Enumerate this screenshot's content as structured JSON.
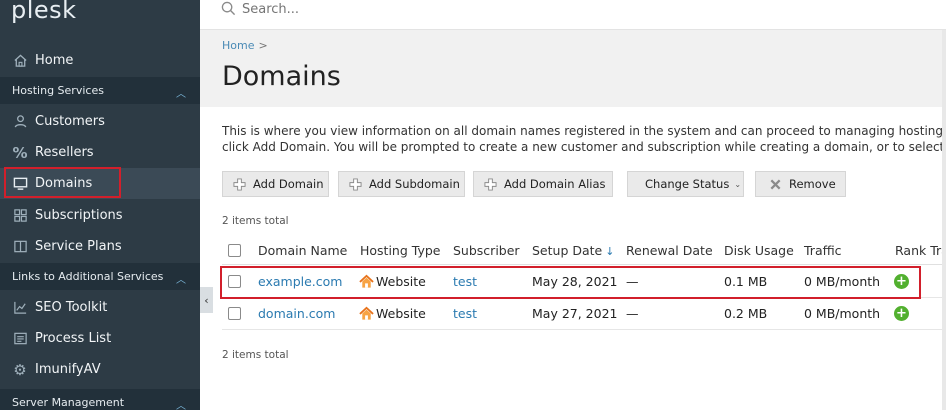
{
  "sidebar": {
    "logo": "plesk",
    "items": [
      {
        "label": "Home",
        "icon": "home-icon"
      },
      {
        "label": "Customers",
        "icon": "user-icon"
      },
      {
        "label": "Resellers",
        "icon": "percent-icon"
      },
      {
        "label": "Domains",
        "icon": "monitor-icon"
      },
      {
        "label": "Subscriptions",
        "icon": "grid-icon"
      },
      {
        "label": "Service Plans",
        "icon": "book-icon"
      },
      {
        "label": "SEO Toolkit",
        "icon": "chart-icon"
      },
      {
        "label": "Process List",
        "icon": "list-icon"
      },
      {
        "label": "ImunifyAV",
        "icon": "gear-icon"
      }
    ],
    "groups": [
      {
        "label": "Hosting Services"
      },
      {
        "label": "Links to Additional Services"
      },
      {
        "label": "Server Management"
      }
    ]
  },
  "search": {
    "placeholder": "Search..."
  },
  "header": {
    "breadcrumb_home": "Home",
    "breadcrumb_sep": ">",
    "title": "Domains"
  },
  "description": {
    "line1": "This is where you view information on all domain names registered in the system and can proceed to managing hosting serv",
    "line2": "click Add Domain. You will be prompted to create a new customer and subscription while creating a domain, or to select fro"
  },
  "toolbar": {
    "add_domain": "Add Domain",
    "add_subdomain": "Add Subdomain",
    "add_domain_alias": "Add Domain Alias",
    "change_status": "Change Status",
    "remove": "Remove"
  },
  "items_total": "2 items total",
  "table": {
    "columns": [
      "Domain Name",
      "Hosting Type",
      "Subscriber",
      "Setup Date",
      "Renewal Date",
      "Disk Usage",
      "Traffic",
      "Rank Tra"
    ],
    "sort_indicator": "↓",
    "rows": [
      {
        "domain": "example.com",
        "hosting": "Website",
        "subscriber": "test",
        "setup": "May 28, 2021",
        "renewal": "—",
        "disk": "0.1 MB",
        "traffic": "0 MB/month"
      },
      {
        "domain": "domain.com",
        "hosting": "Website",
        "subscriber": "test",
        "setup": "May 27, 2021",
        "renewal": "—",
        "disk": "0.2 MB",
        "traffic": "0 MB/month"
      }
    ]
  },
  "colors": {
    "sidebar_bg": "#2d3b45",
    "highlight_border": "#d21f2b",
    "link": "#2a7ab0",
    "rank_add": "#52b02f"
  }
}
